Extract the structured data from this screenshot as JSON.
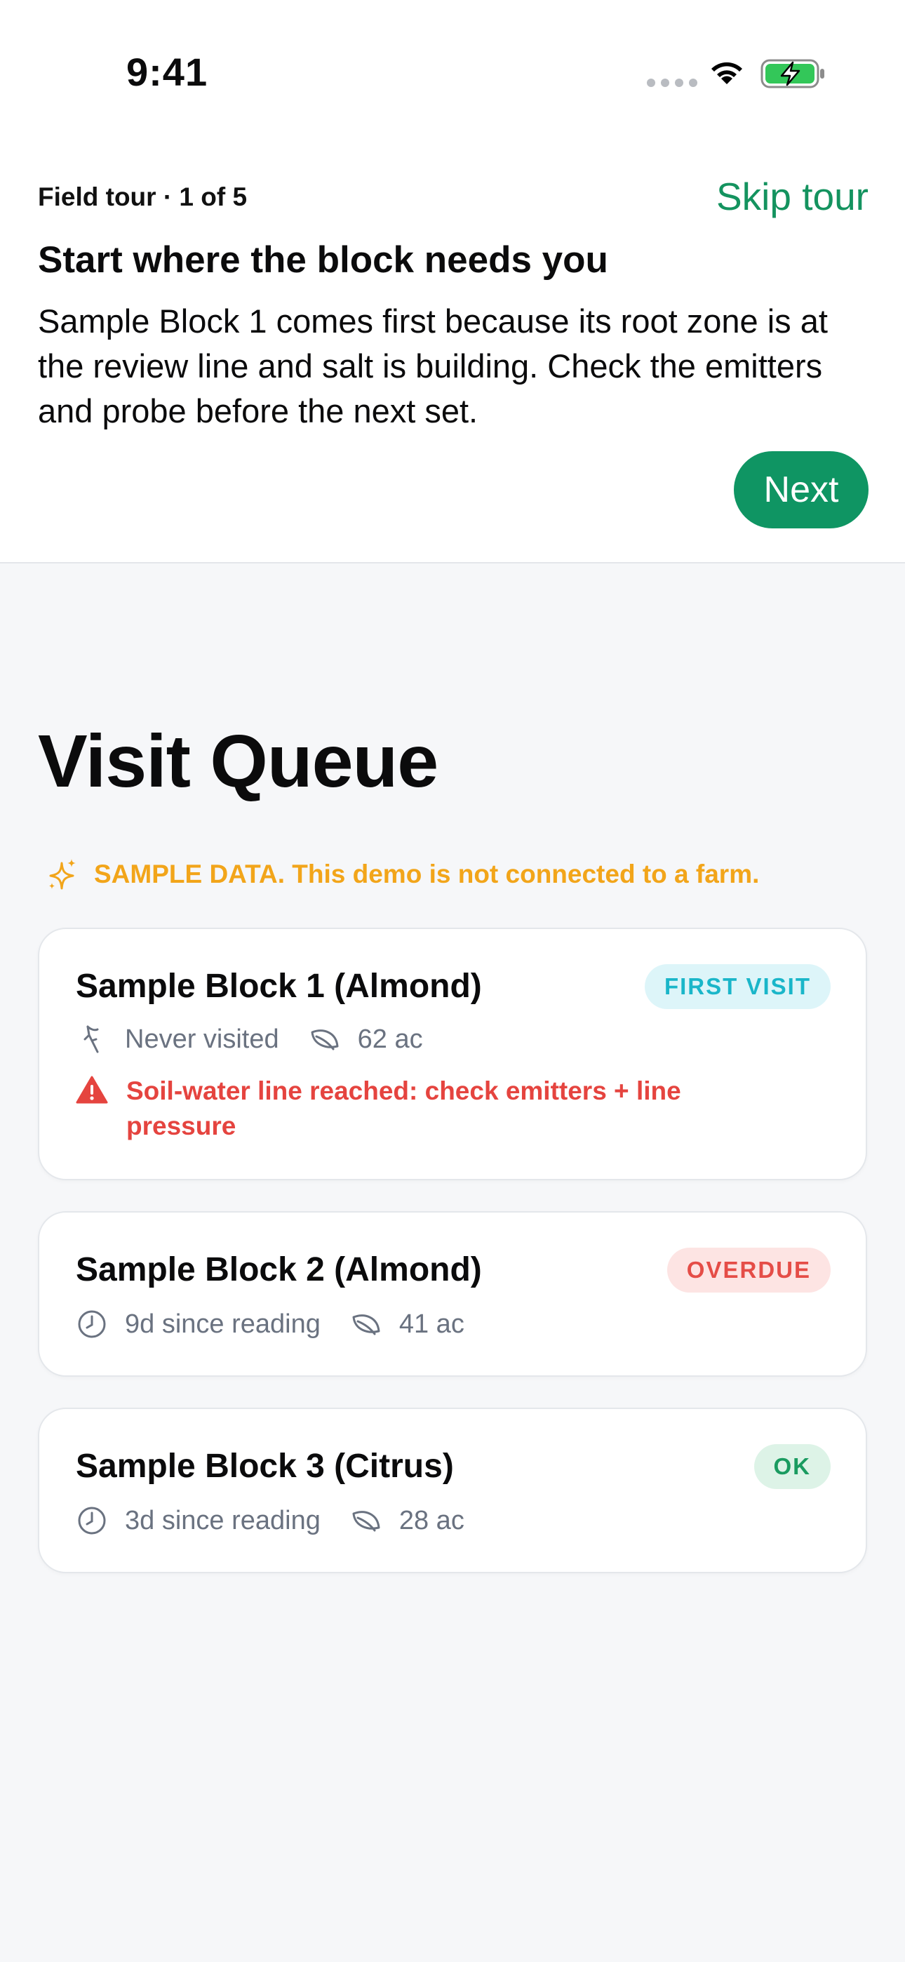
{
  "status_bar": {
    "time": "9:41"
  },
  "tour": {
    "step": "Field tour · 1 of 5",
    "skip_label": "Skip tour",
    "title": "Start where the block needs you",
    "body": "Sample Block 1 comes first because its root zone is at the review line and salt is building. Check the emitters and probe before the next set.",
    "next_label": "Next"
  },
  "page": {
    "title": "Visit Queue",
    "sample_notice": "SAMPLE DATA. This demo is not connected to a farm."
  },
  "blocks": [
    {
      "name": "Sample Block 1 (Almond)",
      "badge": "FIRST VISIT",
      "status_text": "Never visited",
      "status_icon": "probe-icon",
      "area": "62 ac",
      "alert": "Soil-water line reached: check emitters + line pressure"
    },
    {
      "name": "Sample Block 2 (Almond)",
      "badge": "OVERDUE",
      "status_text": "9d since reading",
      "status_icon": "clock-icon",
      "area": "41 ac"
    },
    {
      "name": "Sample Block 3 (Citrus)",
      "badge": "OK",
      "status_text": "3d since reading",
      "status_icon": "clock-icon",
      "area": "28 ac"
    }
  ],
  "colors": {
    "accent": "#0f9563",
    "warning": "#f2a51a",
    "danger": "#e5443f",
    "first_visit": "#1ab6c9"
  }
}
